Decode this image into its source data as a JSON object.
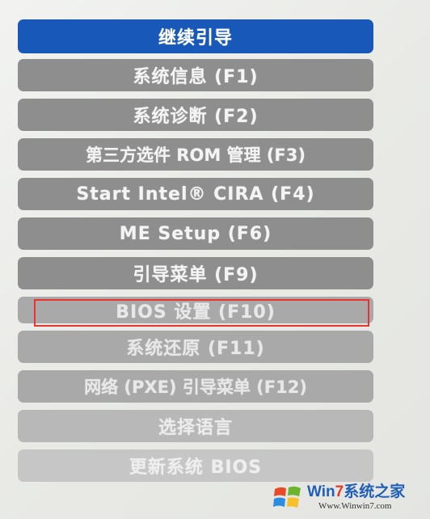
{
  "menu": {
    "items": [
      {
        "label": "继续引导",
        "state": "selected"
      },
      {
        "label": "系统信息 (F1)",
        "state": "normal"
      },
      {
        "label": "系统诊断 (F2)",
        "state": "normal"
      },
      {
        "label": "第三方选件 ROM 管理 (F3)",
        "state": "normal"
      },
      {
        "label": "Start Intel® CIRA (F4)",
        "state": "normal"
      },
      {
        "label": "ME Setup (F6)",
        "state": "normal"
      },
      {
        "label": "引导菜单 (F9)",
        "state": "normal"
      },
      {
        "label": "BIOS 设置 (F10)",
        "state": "faded",
        "annotated": true
      },
      {
        "label": "系统还原 (F11)",
        "state": "faded"
      },
      {
        "label": "网络 (PXE) 引导菜单 (F12)",
        "state": "faded"
      },
      {
        "label": "选择语言",
        "state": "faded2"
      },
      {
        "label": "更新系统 BIOS",
        "state": "faded3"
      }
    ]
  },
  "annotation": {
    "color": "#e8332e"
  },
  "watermark": {
    "title_prefix": "Win",
    "title_seven": "7",
    "title_suffix": "系统之家",
    "url": "Www.Winwin7.com",
    "logo_icon": "windows-flag-icon"
  },
  "colors": {
    "selected": "#1758b8",
    "normal": "#8e8e8e",
    "faded": "#a9a9a9",
    "background": "#eeefec"
  }
}
